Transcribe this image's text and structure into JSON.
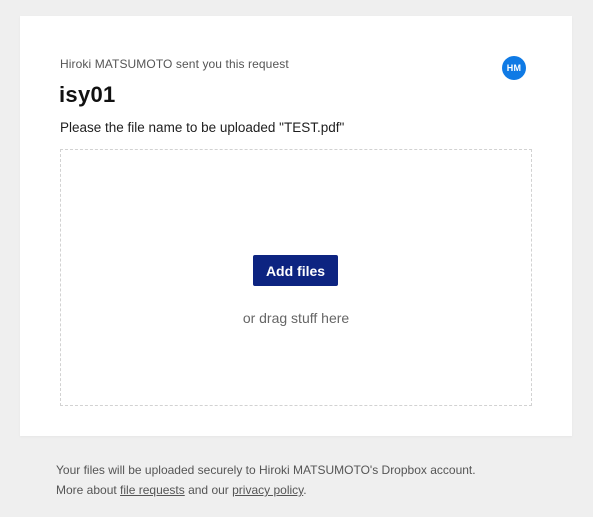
{
  "request": {
    "sender_text": "Hiroki MATSUMOTO sent you this request",
    "avatar_initials": "HM",
    "title": "isy01",
    "description": "Please the file name to be uploaded \"TEST.pdf\""
  },
  "dropzone": {
    "add_button_label": "Add files",
    "drag_text": "or drag stuff here"
  },
  "footer": {
    "line1": "Your files will be uploaded securely to Hiroki MATSUMOTO's Dropbox account.",
    "line2_prefix": "More about ",
    "file_requests_link": "file requests",
    "line2_middle": " and our ",
    "privacy_link": "privacy policy",
    "line2_suffix": "."
  },
  "colors": {
    "avatar_bg": "#0f7ae5",
    "button_bg": "#0d2481",
    "page_bg": "#efefef"
  }
}
